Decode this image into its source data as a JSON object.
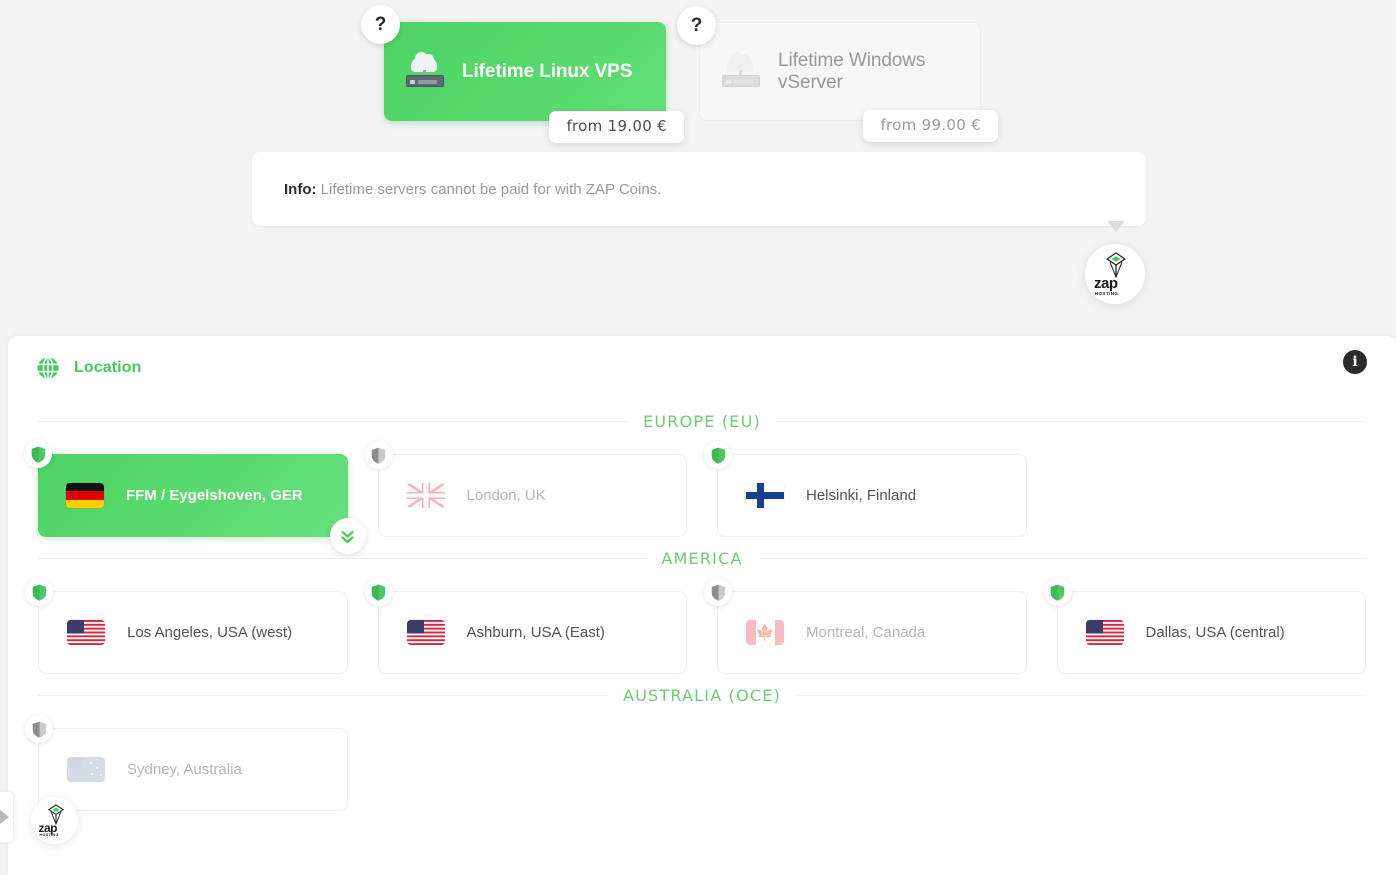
{
  "products": {
    "help_label": "?",
    "items": [
      {
        "title": "Lifetime Linux VPS",
        "price": "from 19.00 €",
        "icon": "cloud-server-icon",
        "state": "active"
      },
      {
        "title": "Lifetime Windows vServer",
        "price": "from 99.00 €",
        "icon": "cloud-server-icon",
        "state": "inactive"
      }
    ]
  },
  "info": {
    "label": "Info:",
    "message": "Lifetime servers cannot be paid for with ZAP Coins."
  },
  "brand": {
    "word": "zap",
    "sub": "HOSTING"
  },
  "location": {
    "title": "Location",
    "globe_icon": "globe-icon",
    "info_icon": "info-circle-icon",
    "accent_color": "#4ac95f",
    "regions": [
      {
        "label": "EUROPE (EU)",
        "cards": [
          {
            "name": "FFM / Eygelshoven, GER",
            "flag": "de",
            "state": "selected",
            "shield": "green"
          },
          {
            "name": "London, UK",
            "flag": "uk",
            "state": "disabled",
            "shield": "gray"
          },
          {
            "name": "Helsinki, Finland",
            "flag": "fi",
            "state": "default",
            "shield": "green"
          }
        ]
      },
      {
        "label": "AMERICA",
        "cards": [
          {
            "name": "Los Angeles, USA (west)",
            "flag": "us",
            "state": "default",
            "shield": "green"
          },
          {
            "name": "Ashburn, USA (East)",
            "flag": "us",
            "state": "default",
            "shield": "green"
          },
          {
            "name": "Montreal, Canada",
            "flag": "ca",
            "state": "disabled",
            "shield": "gray"
          },
          {
            "name": "Dallas, USA (central)",
            "flag": "us",
            "state": "default",
            "shield": "green"
          }
        ]
      },
      {
        "label": "AUSTRALIA (OCE)",
        "cards": [
          {
            "name": "Sydney, Australia",
            "flag": "au",
            "state": "disabled",
            "shield": "gray"
          }
        ]
      }
    ]
  }
}
